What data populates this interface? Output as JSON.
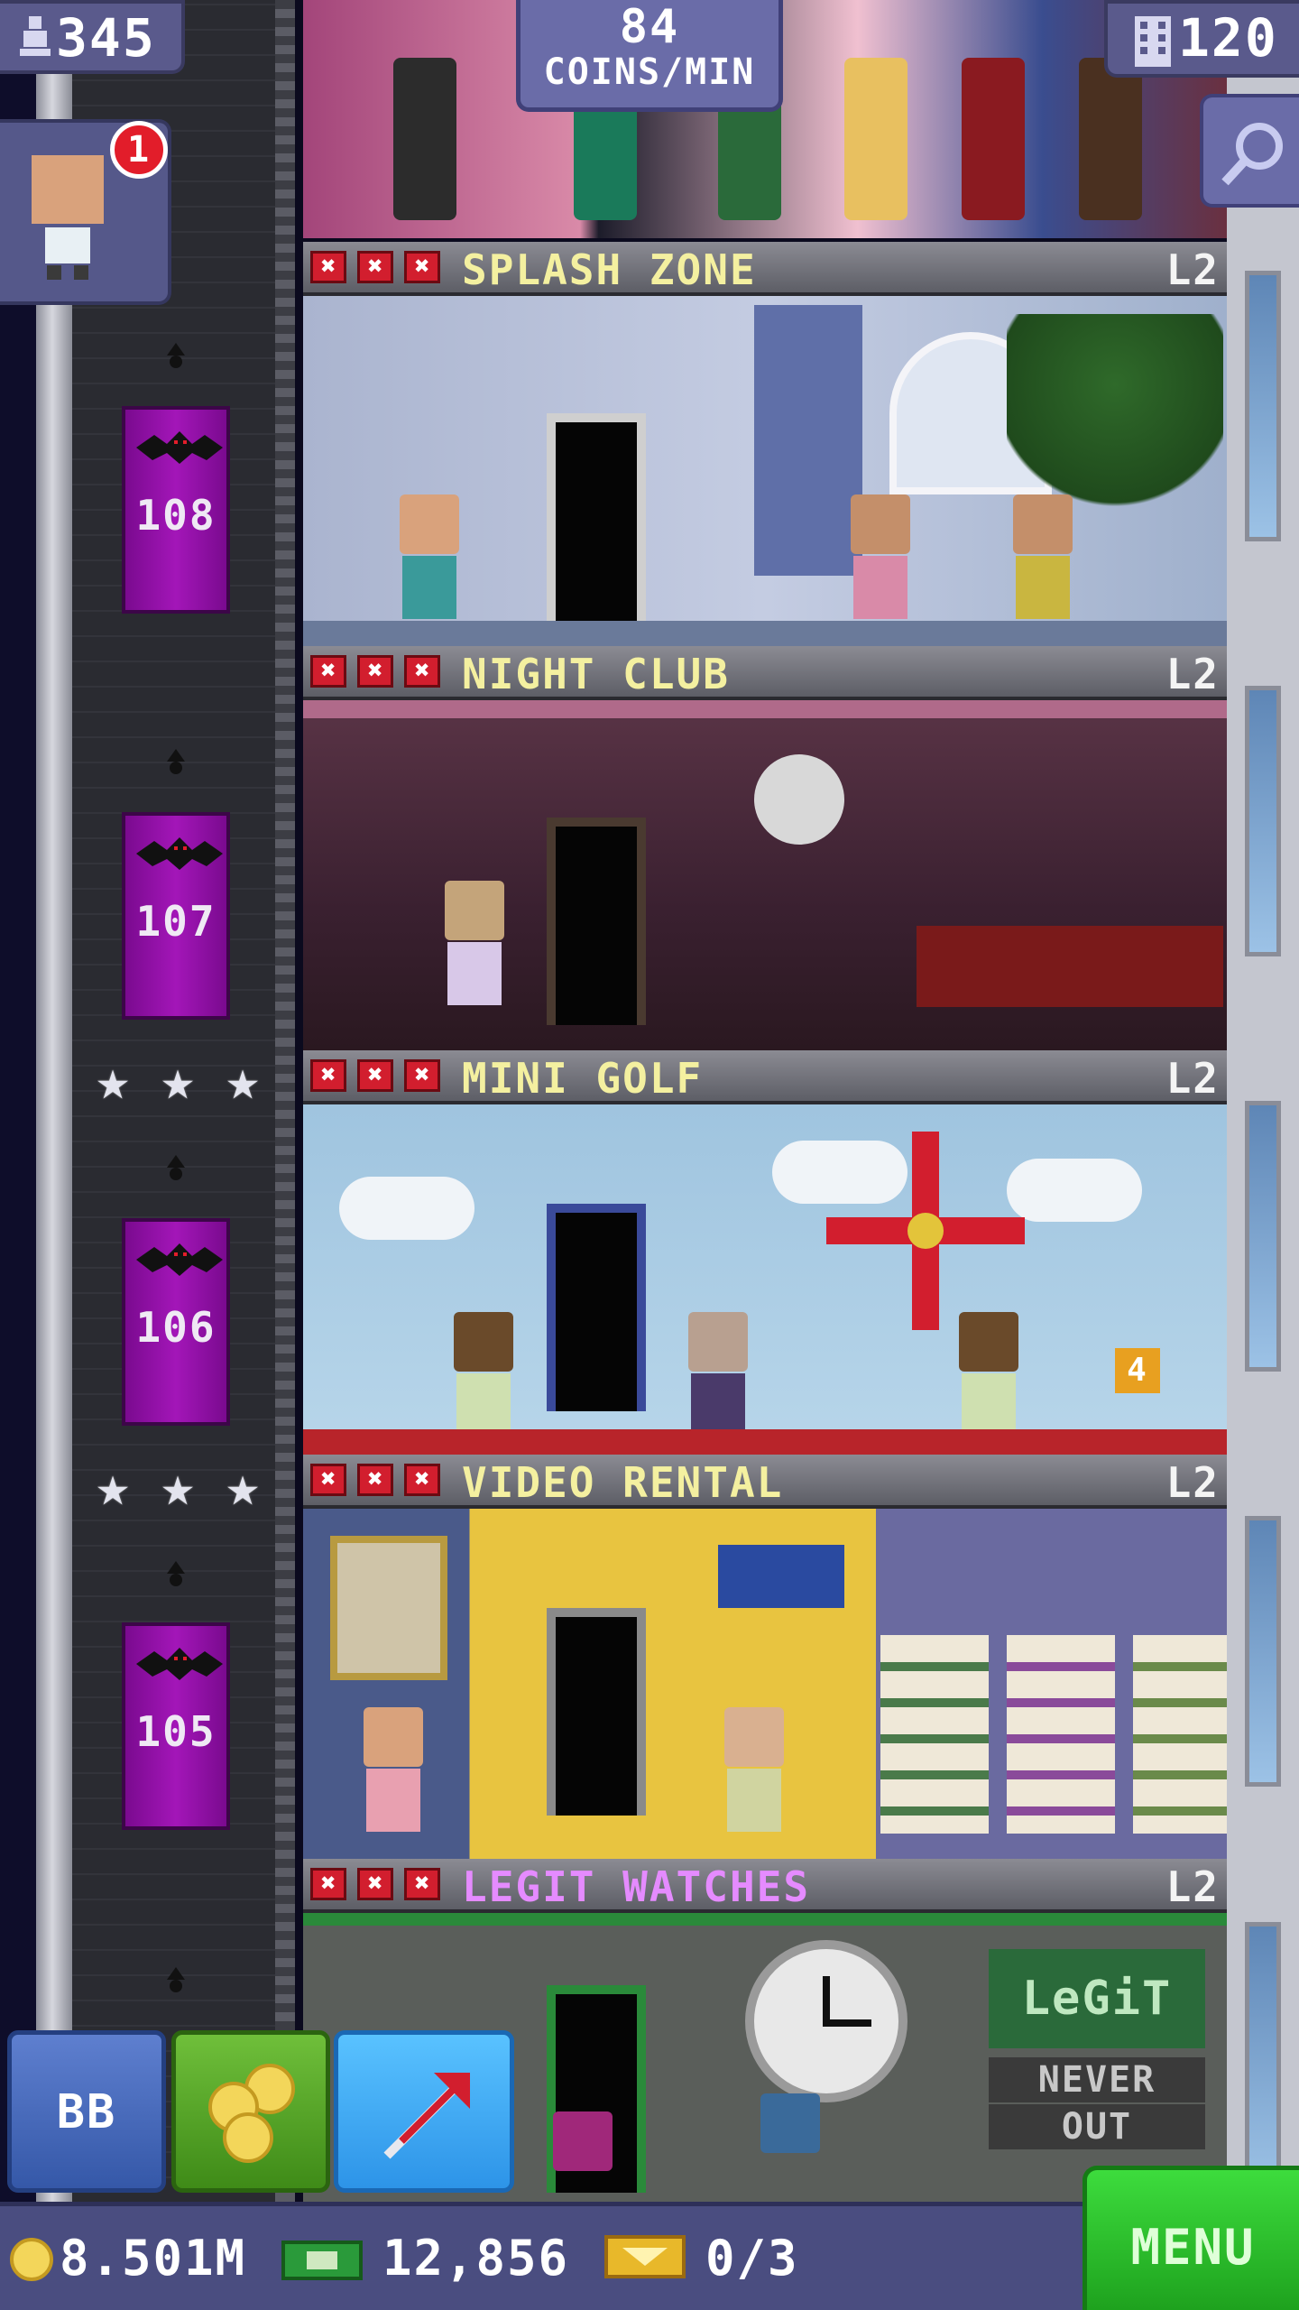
{
  "hud": {
    "population": "345",
    "coins_per_min_value": "84",
    "coins_per_min_label": "COINS/MIN",
    "floor_count": "120",
    "bitizen_notification_count": "1"
  },
  "elevator": {
    "floor_numbers": [
      "108",
      "107",
      "106",
      "105"
    ]
  },
  "floors": [
    {
      "name": "SPLASH ZONE",
      "level": "L2",
      "name_color": "#f4f0a0"
    },
    {
      "name": "NIGHT CLUB",
      "level": "L2",
      "name_color": "#f4f0a0"
    },
    {
      "name": "MINI GOLF",
      "level": "L2",
      "name_color": "#f4f0a0"
    },
    {
      "name": "VIDEO RENTAL",
      "level": "L2",
      "name_color": "#f4f0a0"
    },
    {
      "name": "LEGIT WATCHES",
      "level": "L2",
      "name_color": "#e58bff"
    }
  ],
  "room_text": {
    "golf_hole_sign": "4",
    "watch_store_sign_line1": "LeGiT",
    "watch_store_sign_line2": "NEVER",
    "watch_store_sign_line3": "OUT"
  },
  "toolbar": {
    "bitbook_label": "BB"
  },
  "status": {
    "coins": "8.501M",
    "bux": "12,856",
    "tickets": "0/3",
    "menu_label": "MENU"
  },
  "colors": {
    "accent_green": "#1ea21e",
    "elevator_purple": "#a316b8",
    "hud_purple": "#5a5a8c",
    "floor_title_yellow": "#f4f0a0",
    "floor_title_pink": "#e58bff"
  }
}
